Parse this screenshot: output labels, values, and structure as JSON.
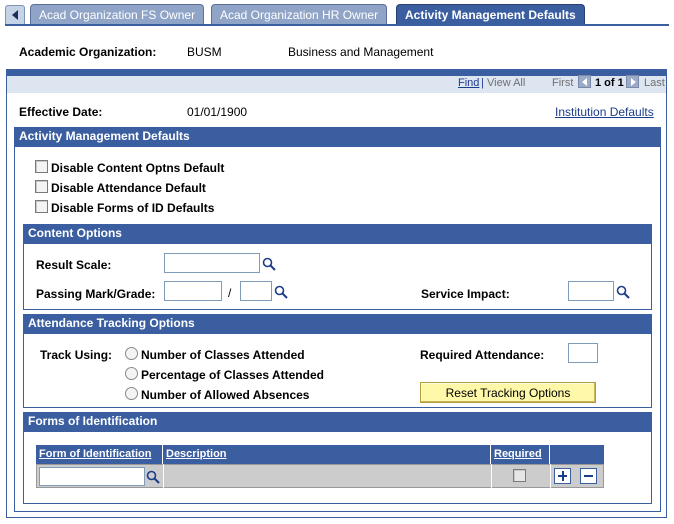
{
  "tabs": [
    {
      "label": "Acad Organization FS Owner",
      "active": false
    },
    {
      "label": "Acad Organization HR Owner",
      "active": false
    },
    {
      "label": "Activity Management Defaults",
      "active": true
    }
  ],
  "header": {
    "label": "Academic Organization:",
    "code": "BUSM",
    "description": "Business and Management"
  },
  "nav": {
    "find": "Find",
    "separator": "|",
    "view_all": "View All",
    "first": "First",
    "count": "1 of 1",
    "last": "Last"
  },
  "effective": {
    "label": "Effective Date:",
    "value": "01/01/1900",
    "institution_link": "Institution Defaults"
  },
  "amd": {
    "title": "Activity Management Defaults",
    "checkboxes": [
      {
        "label": "Disable Content Optns Default",
        "checked": false
      },
      {
        "label": "Disable Attendance Default",
        "checked": false
      },
      {
        "label": "Disable Forms of ID Defaults",
        "checked": false
      }
    ]
  },
  "content_options": {
    "title": "Content Options",
    "result_scale_label": "Result Scale:",
    "result_scale_value": "",
    "passing_label": "Passing Mark/Grade:",
    "passing_value1": "",
    "slash": "/",
    "passing_value2": "",
    "service_impact_label": "Service Impact:",
    "service_impact_value": ""
  },
  "attendance": {
    "title": "Attendance Tracking Options",
    "track_label": "Track Using:",
    "options": [
      "Number of Classes Attended",
      "Percentage of Classes Attended",
      "Number of Allowed Absences"
    ],
    "required_label": "Required Attendance:",
    "required_value": "",
    "reset_button": "Reset Tracking Options"
  },
  "forms_id": {
    "title": "Forms of Identification",
    "columns": [
      "Form of Identification",
      "Description",
      "Required"
    ],
    "row": {
      "form_value": "",
      "description": "",
      "required": false
    }
  },
  "colors": {
    "header_blue": "#3b5ea0",
    "button_yellow": "#fff8a8",
    "link_blue": "#1c3c8c"
  }
}
